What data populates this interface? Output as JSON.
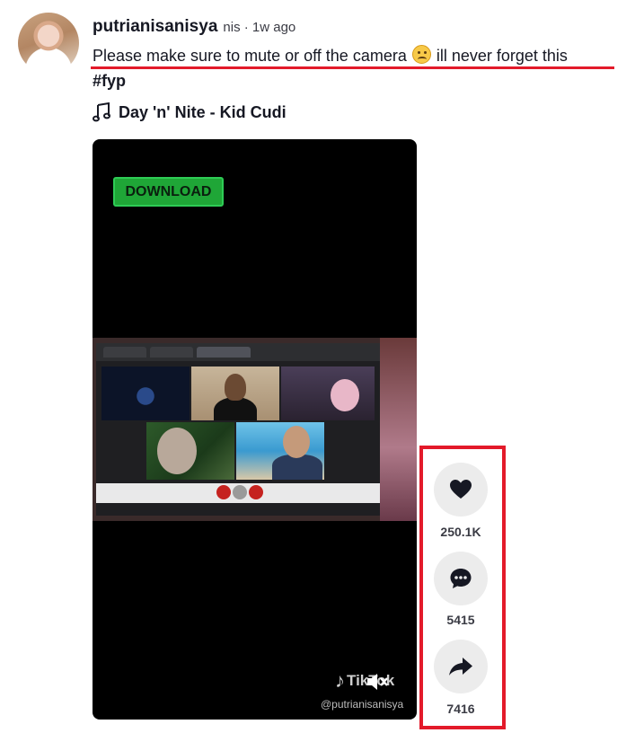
{
  "post": {
    "username": "putrianisanisya",
    "meta": "nis · 1w ago",
    "caption_before": "Please make sure to mute or off the camera ",
    "caption_after": " ill never forget this",
    "hashtag": "#fyp",
    "music": "Day 'n' Nite - Kid Cudi"
  },
  "video": {
    "download_label": "DOWNLOAD",
    "watermark_brand": "TikTok",
    "watermark_handle": "@putrianisanisya"
  },
  "actions": {
    "likes": "250.1K",
    "comments": "5415",
    "shares": "7416"
  },
  "colors": {
    "highlight": "#e31a2a",
    "download_green": "#1fa637"
  },
  "icons": {
    "music": "music-note-icon",
    "like": "heart-icon",
    "comment": "comment-icon",
    "share": "share-arrow-icon",
    "sound": "muted-speaker-icon",
    "emoji": "disappointed-face-emoji"
  }
}
